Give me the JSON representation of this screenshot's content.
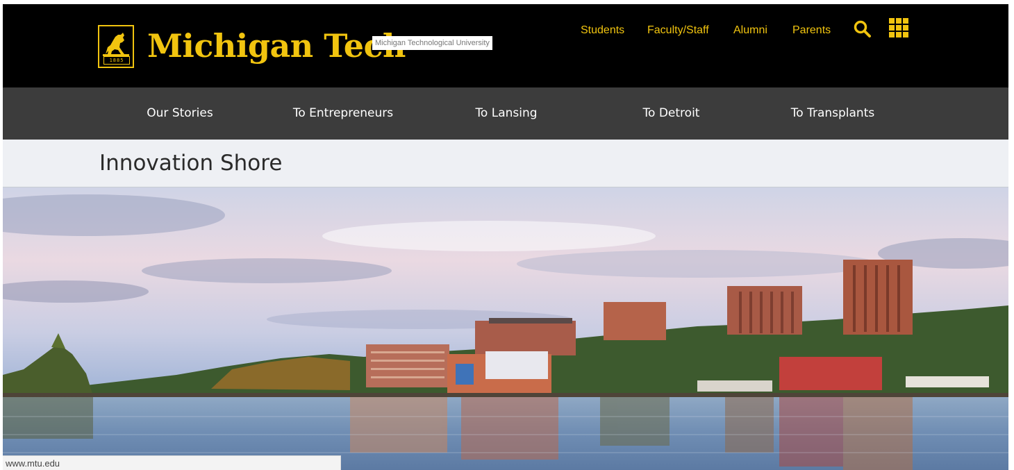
{
  "header": {
    "brand": "Michigan Tech",
    "brand_subtitle": "Michigan Technological University",
    "logo_year": "1885",
    "audience_links": [
      "Students",
      "Faculty/Staff",
      "Alumni",
      "Parents"
    ],
    "search_icon": "search-icon",
    "apps_icon": "grid-icon",
    "accent_color": "#f1c40f"
  },
  "nav": {
    "items": [
      "Our Stories",
      "To Entrepreneurs",
      "To Lansing",
      "To Detroit",
      "To Transplants"
    ]
  },
  "page": {
    "title": "Innovation Shore"
  },
  "status_bar": {
    "url": "www.mtu.edu"
  }
}
